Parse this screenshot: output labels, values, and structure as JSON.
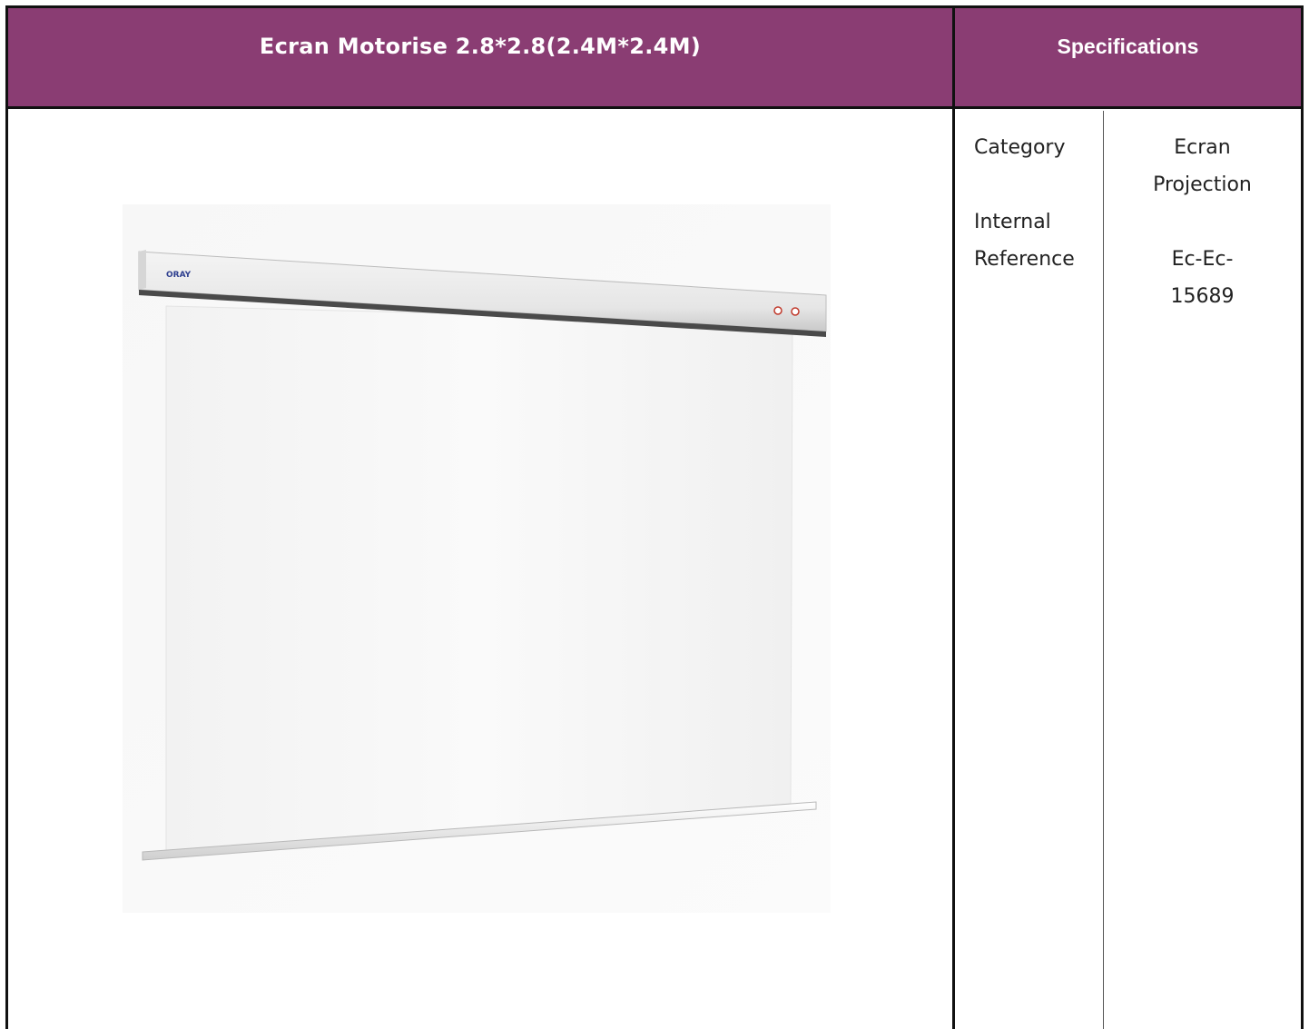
{
  "product": {
    "title": "Ecran Motorise 2.8*2.8(2.4M*2.4M)",
    "image_icon": "projection-screen-image",
    "brand_mark": "ORAY"
  },
  "specifications": {
    "heading": "Specifications",
    "rows": [
      {
        "label": "Category",
        "value_lines": [
          "Ecran",
          "Projection"
        ]
      },
      {
        "label_lines": [
          "Internal",
          "Reference"
        ],
        "value_lines": [
          "Ec-Ec-",
          "15689"
        ]
      }
    ]
  },
  "colors": {
    "header_bg": "#8a3d73",
    "header_text": "#ffffff",
    "border": "#111111"
  }
}
